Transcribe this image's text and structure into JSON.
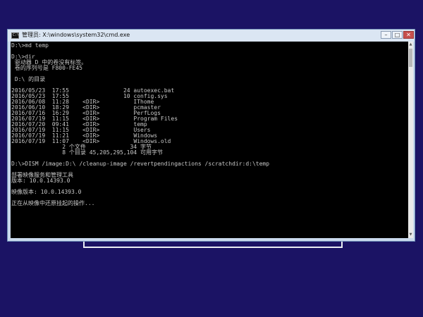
{
  "window": {
    "icon_text": "C:\\",
    "title": "管理员: X:\\windows\\system32\\cmd.exe",
    "buttons": {
      "minimize": "–",
      "maximize": "□",
      "close": "✕"
    }
  },
  "console": {
    "lines": [
      "D:\\>md temp",
      "",
      "D:\\>dir",
      " 驱动器 D 中的卷没有标签。",
      " 卷的序列号是 F800-FE45",
      "",
      " D:\\ 的目录",
      "",
      "2016/05/23  17:55                24 autoexec.bat",
      "2016/05/23  17:55                10 config.sys",
      "2016/06/08  11:28    <DIR>          IThome",
      "2016/06/10  18:29    <DIR>          pcmaster",
      "2016/07/16  16:29    <DIR>          PerfLogs",
      "2016/07/19  11:15    <DIR>          Program Files",
      "2016/07/20  09:41    <DIR>          temp",
      "2016/07/19  11:15    <DIR>          Users",
      "2016/07/19  11:21    <DIR>          Windows",
      "2016/07/19  11:07    <DIR>          Windows.old",
      "               2 个文件             34 字节",
      "               8 个目录 45,205,295,104 可用字节",
      "",
      "D:\\>DISM /image:D:\\ /cleanup-image /revertpendingactions /scratchdir:d:\\temp",
      "",
      "部署映像服务和管理工具",
      "版本: 10.0.14393.0",
      "",
      "映像版本: 10.0.14393.0",
      "",
      "正在从映像中还原挂起的操作...",
      ""
    ]
  },
  "scrollbar": {
    "up_arrow": "▲",
    "down_arrow": "▼"
  },
  "colors": {
    "desktop_background": "#1b1364",
    "console_background": "#000000",
    "console_text": "#c8c8c8",
    "titlebar": "#dbe6f3",
    "close_button": "#c7504d"
  }
}
